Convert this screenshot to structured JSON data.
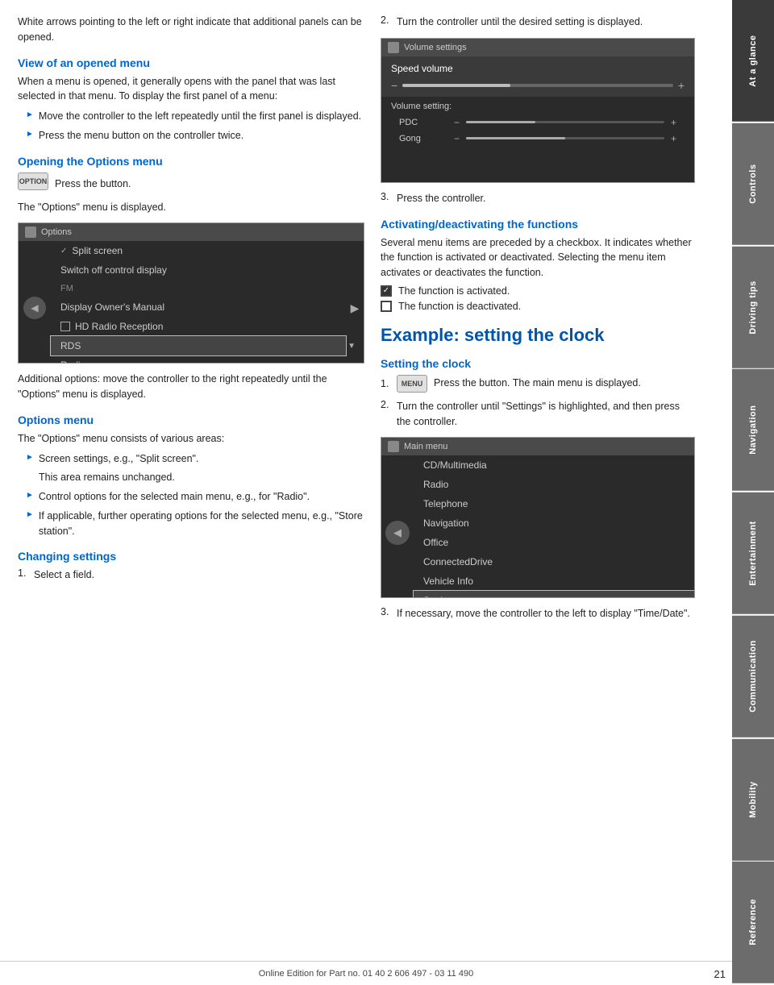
{
  "sidebar": {
    "tabs": [
      {
        "label": "At a glance",
        "active": true
      },
      {
        "label": "Controls",
        "active": false
      },
      {
        "label": "Driving tips",
        "active": false
      },
      {
        "label": "Navigation",
        "active": false
      },
      {
        "label": "Entertainment",
        "active": false
      },
      {
        "label": "Communication",
        "active": false
      },
      {
        "label": "Mobility",
        "active": false
      },
      {
        "label": "Reference",
        "active": false
      }
    ]
  },
  "left_col": {
    "intro_text": "White arrows pointing to the left or right indicate that additional panels can be opened.",
    "section1_heading": "View of an opened menu",
    "section1_text": "When a menu is opened, it generally opens with the panel that was last selected in that menu. To display the first panel of a menu:",
    "bullet1": "Move the controller to the left repeatedly until the first panel is displayed.",
    "bullet2": "Press the menu button on the controller twice.",
    "section2_heading": "Opening the Options menu",
    "option_btn_label": "OPTION",
    "option_instruction": "Press the button.",
    "options_displayed": "The \"Options\" menu is displayed.",
    "options_screen": {
      "title": "Options",
      "rows": [
        {
          "text": "Split screen",
          "checked": true,
          "type": "checked"
        },
        {
          "text": "Switch off control display",
          "type": "normal"
        },
        {
          "text": "FM",
          "type": "header"
        },
        {
          "text": "Display Owner's Manual",
          "type": "normal"
        },
        {
          "text": "HD Radio Reception",
          "checked": false,
          "type": "checkbox"
        },
        {
          "text": "RDS",
          "type": "selected"
        },
        {
          "text": "Radio",
          "type": "normal"
        }
      ]
    },
    "additional_options_text": "Additional options: move the controller to the right repeatedly until the \"Options\" menu is displayed.",
    "section3_heading": "Options menu",
    "options_menu_intro": "The \"Options\" menu consists of various areas:",
    "options_bullets": [
      {
        "text": "Screen settings, e.g., \"Split screen\"."
      },
      {
        "text": "This area remains unchanged."
      },
      {
        "text": "Control options for the selected main menu, e.g., for \"Radio\"."
      },
      {
        "text": "If applicable, further operating options for the selected menu, e.g., \"Store station\"."
      }
    ],
    "section4_heading": "Changing settings",
    "step1_label": "1.",
    "step1_text": "Select a field."
  },
  "right_col": {
    "step2_label": "2.",
    "step2_text": "Turn the controller until the desired setting is displayed.",
    "volume_screen": {
      "title": "Volume settings",
      "speed_volume_label": "Speed volume",
      "slider_minus": "−",
      "slider_plus": "+",
      "volume_setting_label": "Volume setting:",
      "rows": [
        {
          "label": "PDC",
          "minus": "−",
          "plus": "+"
        },
        {
          "label": "Gong",
          "minus": "−",
          "plus": "+"
        }
      ]
    },
    "step3_label": "3.",
    "step3_text": "Press the controller.",
    "section_activating_heading": "Activating/deactivating the functions",
    "activating_text": "Several menu items are preceded by a checkbox. It indicates whether the function is activated or deactivated. Selecting the menu item activates or deactivates the function.",
    "activated_label": "The function is activated.",
    "deactivated_label": "The function is deactivated.",
    "example_heading": "Example: setting the clock",
    "setting_clock_heading": "Setting the clock",
    "clock_step1_label": "1.",
    "menu_btn_label": "MENU",
    "clock_step1_text": "Press the button. The main menu is displayed.",
    "clock_step2_label": "2.",
    "clock_step2_text": "Turn the controller until \"Settings\" is highlighted, and then press the controller.",
    "main_menu_screen": {
      "title": "Main menu",
      "rows": [
        {
          "text": "CD/Multimedia",
          "type": "normal"
        },
        {
          "text": "Radio",
          "type": "normal"
        },
        {
          "text": "Telephone",
          "type": "normal"
        },
        {
          "text": "Navigation",
          "type": "normal"
        },
        {
          "text": "Office",
          "type": "normal"
        },
        {
          "text": "ConnectedDrive",
          "type": "normal"
        },
        {
          "text": "Vehicle Info",
          "type": "normal"
        },
        {
          "text": "Settings",
          "type": "selected"
        }
      ]
    },
    "clock_step3_label": "3.",
    "clock_step3_text": "If necessary, move the controller to the left to display \"Time/Date\"."
  },
  "footer": {
    "text": "Online Edition for Part no. 01 40 2 606 497 - 03 11 490",
    "page_number": "21"
  }
}
